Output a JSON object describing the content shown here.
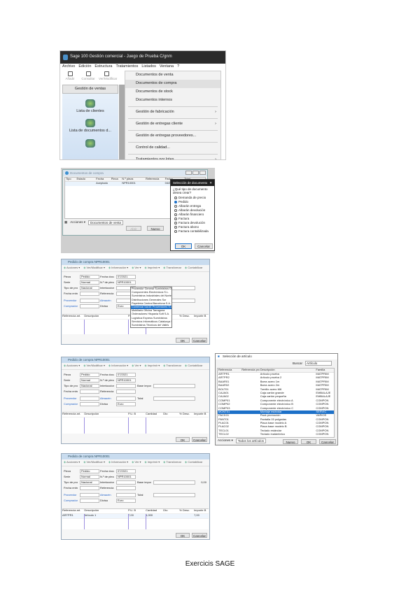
{
  "shot1": {
    "title": "Sage 100 Gestión comercial - Juego de Prueba C/gnm",
    "menubar": [
      "Archivo",
      "Edición",
      "Estructura",
      "Tratamientos",
      "Listados",
      "Ventana",
      "?"
    ],
    "toolbar": [
      "Añadir",
      "Consultar",
      "Ver/Modificar"
    ],
    "sidebar_header": "Gestión de ventas",
    "sidebar_items": [
      "Lista de clientes",
      "Lista de documentos d..."
    ],
    "menu": [
      {
        "label": "Documentos de venta",
        "submenu": false
      },
      {
        "label": "Documentos de compra",
        "submenu": false,
        "highlighted": true
      },
      {
        "label": "Documentos de stock",
        "submenu": false
      },
      {
        "label": "Documentos internos",
        "submenu": false
      },
      {
        "label": "Gestión de fabricación",
        "submenu": true
      },
      {
        "label": "Gestión de entregas cliente",
        "submenu": true
      },
      {
        "label": "Gestión de entregas proveedores...",
        "submenu": false
      },
      {
        "label": "Control de calidad...",
        "submenu": false
      },
      {
        "label": "Tratamientos por lotes",
        "submenu": true
      }
    ]
  },
  "shot2": {
    "window_title": "Documentos de compra",
    "columns": [
      "Tipo",
      "Estado",
      "Fecha",
      "Pieza",
      "N.º pieza",
      "Referencia",
      "Fecha",
      "Total"
    ],
    "row": [
      "",
      "",
      "Aceptado",
      "",
      "NPR10001",
      "",
      "04/2021",
      ""
    ],
    "bottom_tabs": [
      "Acciones ▾",
      "Documentos de venta"
    ],
    "buttons": [
      "Abrir",
      "Nuevo"
    ],
    "dialog": {
      "title": "Selección de documento",
      "question": "¿Qué tipo de documento desea crear?",
      "options": [
        "Demanda de precio",
        "Pedido",
        "Albarán entrega",
        "Albarán devolución",
        "Albarán financiero",
        "Factura",
        "Factura devolución",
        "Factura abono",
        "Factura contabilizada"
      ],
      "selected": 1,
      "ok": "OK",
      "cancel": "Cancelar"
    }
  },
  "form": {
    "window_title": "Pedido de compra NPR10001",
    "toolbar": [
      "Acciones ▾",
      "Ver/Modificar ▾",
      "Información ▾",
      "Ver ▾",
      "Imprimir ▾",
      "Transformar",
      "Contabilizar"
    ],
    "labels": [
      "Pieza",
      "Serie",
      "Tipo de proveedor",
      "Fecha entrega",
      "Proveedor",
      "Comprador",
      "Fecha documento",
      "N.º de pieza",
      "Interlocutor",
      "Referencia",
      "Almacén",
      "Divisa",
      "Base imponible",
      "Total"
    ],
    "values": [
      "Pedido",
      "Normal",
      "Nacional",
      "",
      "",
      "",
      "07/2021",
      "NPR10001",
      "",
      "",
      "",
      "Euro",
      "",
      ""
    ],
    "lines_columns": [
      "Referencia art.",
      "Descripción",
      "P.U. B",
      "Cantidad",
      "Dto",
      "% Desc.",
      "Importe B"
    ],
    "line": [
      "ARTPR1",
      "Artículo 1",
      "7,00",
      "1,000",
      "",
      "",
      "7,00"
    ],
    "total": "0,00",
    "buttons": [
      "OK",
      "Cancelar"
    ],
    "dropdown": [
      "Proveedor General Suministros Oficina",
      "Componentes Electrónicos S.L.",
      "Suministros Industriales del Norte",
      "Distribuciones Generales Sur",
      "Papelería Central Barcelona S.A.",
      "Comercial SAGE Proveedores S.A.",
      "Mobiliario Oficina Tarragona",
      "Ordenadores Hispania Soft S.A.",
      "Logística Express Suministros",
      "Servicios Informáticos Catalunya S.L.",
      "Suministros Técnicos del Vallès"
    ]
  },
  "selector": {
    "title": "Selección de artículo",
    "search_label": "Buscar",
    "search_value": "Artículo",
    "columns": [
      "Referencia",
      "Referencia prov.",
      "Descripción",
      "Familia"
    ],
    "rows": [
      [
        "ARTPR1",
        "",
        "Artículo prueba",
        "MATPRIM"
      ],
      [
        "ARTPR2",
        "",
        "Artículo prueba 2",
        "MATPRIM"
      ],
      [
        "BAAR01",
        "",
        "Barra acero 1m",
        "MATPRIM"
      ],
      [
        "BAAR02",
        "",
        "Barra acero 2m",
        "MATPRIM"
      ],
      [
        "BOLT01",
        "",
        "Tornillo acero M6",
        "MATPRIM"
      ],
      [
        "CAJA01",
        "",
        "Caja cartón grande",
        "EMBALAJE"
      ],
      [
        "CAJA02",
        "",
        "Caja cartón pequeña",
        "EMBALAJE"
      ],
      [
        "COMP01",
        "",
        "Componente electrónico A",
        "COMPON"
      ],
      [
        "COMP02",
        "",
        "Componente electrónico B",
        "COMPON"
      ],
      [
        "COMP03",
        "",
        "Componente electrónico C",
        "COMPON"
      ],
      [
        "MONT01",
        "",
        "Montaje estándar",
        "SERVIC"
      ],
      [
        "PACK01",
        "",
        "Pack promoción",
        "VARIOS"
      ],
      [
        "PANT01",
        "",
        "Pantalla 15 pulgadas",
        "COMPON"
      ],
      [
        "PLAC01",
        "",
        "Placa base modelo A",
        "COMPON"
      ],
      [
        "PLAC02",
        "",
        "Placa base modelo B",
        "COMPON"
      ],
      [
        "TECL01",
        "",
        "Teclado estándar",
        "COMPON"
      ],
      [
        "TECL02",
        "",
        "Teclado inalámbrico",
        "COMPON"
      ]
    ],
    "selected": 10,
    "bottom": [
      "Acciones ▾",
      "Todos los artículos"
    ],
    "buttons": [
      "Nuevo",
      "OK",
      "Cancelar"
    ]
  },
  "footer": "Exercicis SAGE"
}
